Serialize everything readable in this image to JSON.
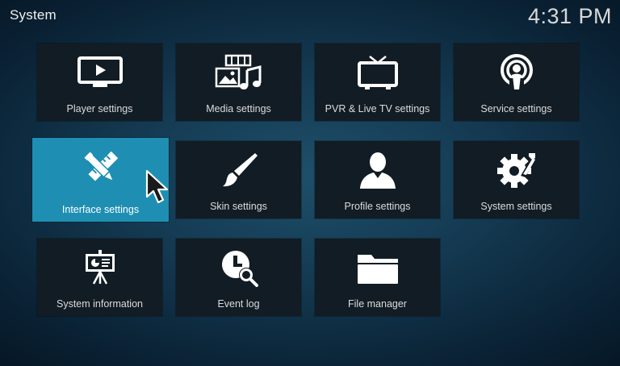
{
  "header": {
    "title": "System",
    "clock": "4:31 PM"
  },
  "tiles": [
    {
      "label": "Player settings",
      "icon": "monitor-play-icon"
    },
    {
      "label": "Media settings",
      "icon": "media-icon"
    },
    {
      "label": "PVR & Live TV settings",
      "icon": "tv-icon"
    },
    {
      "label": "Service settings",
      "icon": "podcast-icon"
    },
    {
      "label": "Interface settings",
      "icon": "pencil-ruler-icon",
      "focused": true
    },
    {
      "label": "Skin settings",
      "icon": "paintbrush-icon"
    },
    {
      "label": "Profile settings",
      "icon": "user-icon"
    },
    {
      "label": "System settings",
      "icon": "gear-wrench-icon"
    },
    {
      "label": "System information",
      "icon": "presentation-icon"
    },
    {
      "label": "Event log",
      "icon": "clock-search-icon"
    },
    {
      "label": "File manager",
      "icon": "folder-icon"
    }
  ],
  "colors": {
    "focus": "#1e8fb3",
    "tile": "#121c24"
  }
}
